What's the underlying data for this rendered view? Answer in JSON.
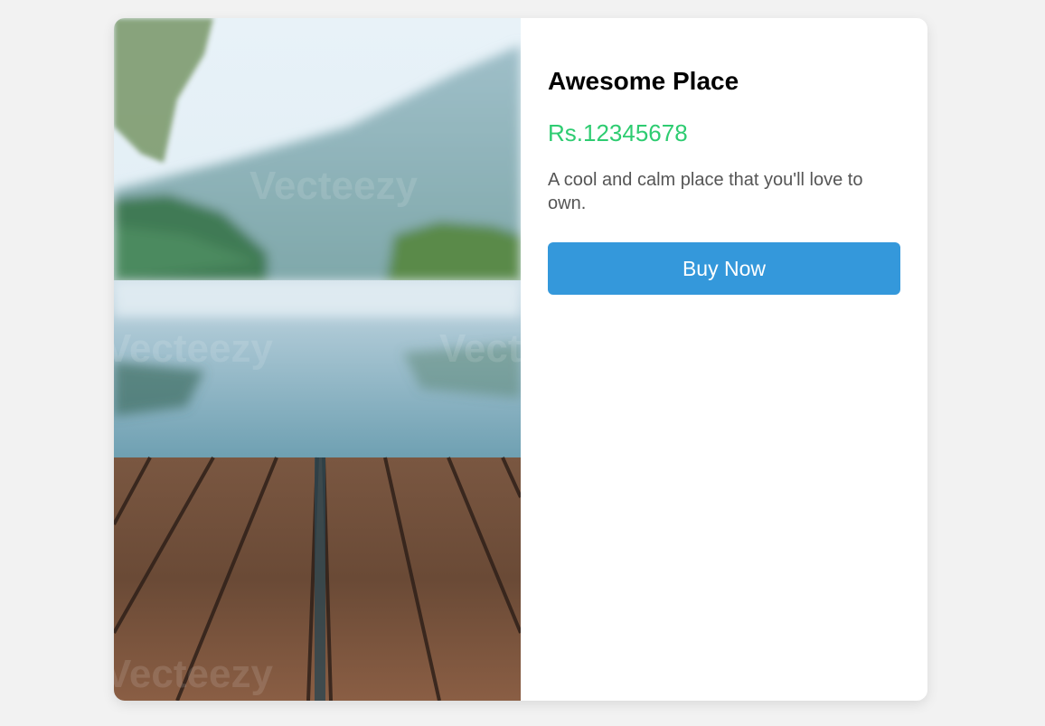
{
  "product": {
    "title": "Awesome Place",
    "price": "Rs.12345678",
    "description": "A cool and calm place that you'll love to own.",
    "buy_label": "Buy Now"
  },
  "image": {
    "watermark_text": "Vecteezy"
  },
  "colors": {
    "price": "#2ecc71",
    "button": "#3498db",
    "background": "#f2f2f2"
  }
}
